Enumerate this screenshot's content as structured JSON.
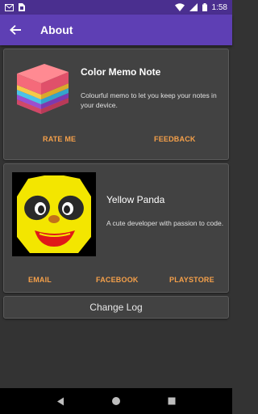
{
  "status": {
    "time": "1:58",
    "icons": [
      "gmail-icon",
      "sim-card-icon",
      "wifi-icon",
      "signal-icon",
      "battery-icon"
    ]
  },
  "appbar": {
    "title": "About",
    "back_icon": "arrow-back-icon",
    "color": "#5e3fb4"
  },
  "app_card": {
    "title": "Color Memo Note",
    "description": "Colourful memo to let you keep your notes in your device.",
    "rate_label": "RATE ME",
    "feedback_label": "FEEDBACK"
  },
  "developer_card": {
    "name": "Yellow Panda",
    "description": "A cute developer with passion to code.",
    "email_label": "EMAIL",
    "facebook_label": "FACEBOOK",
    "playstore_label": "PLAYSTORE"
  },
  "changelog": {
    "label": "Change Log"
  },
  "colors": {
    "accent": "#f5a04a",
    "background": "#333333",
    "card": "#424242"
  },
  "navbar": {
    "icons": [
      "back-triangle-icon",
      "home-circle-icon",
      "recents-square-icon"
    ]
  }
}
